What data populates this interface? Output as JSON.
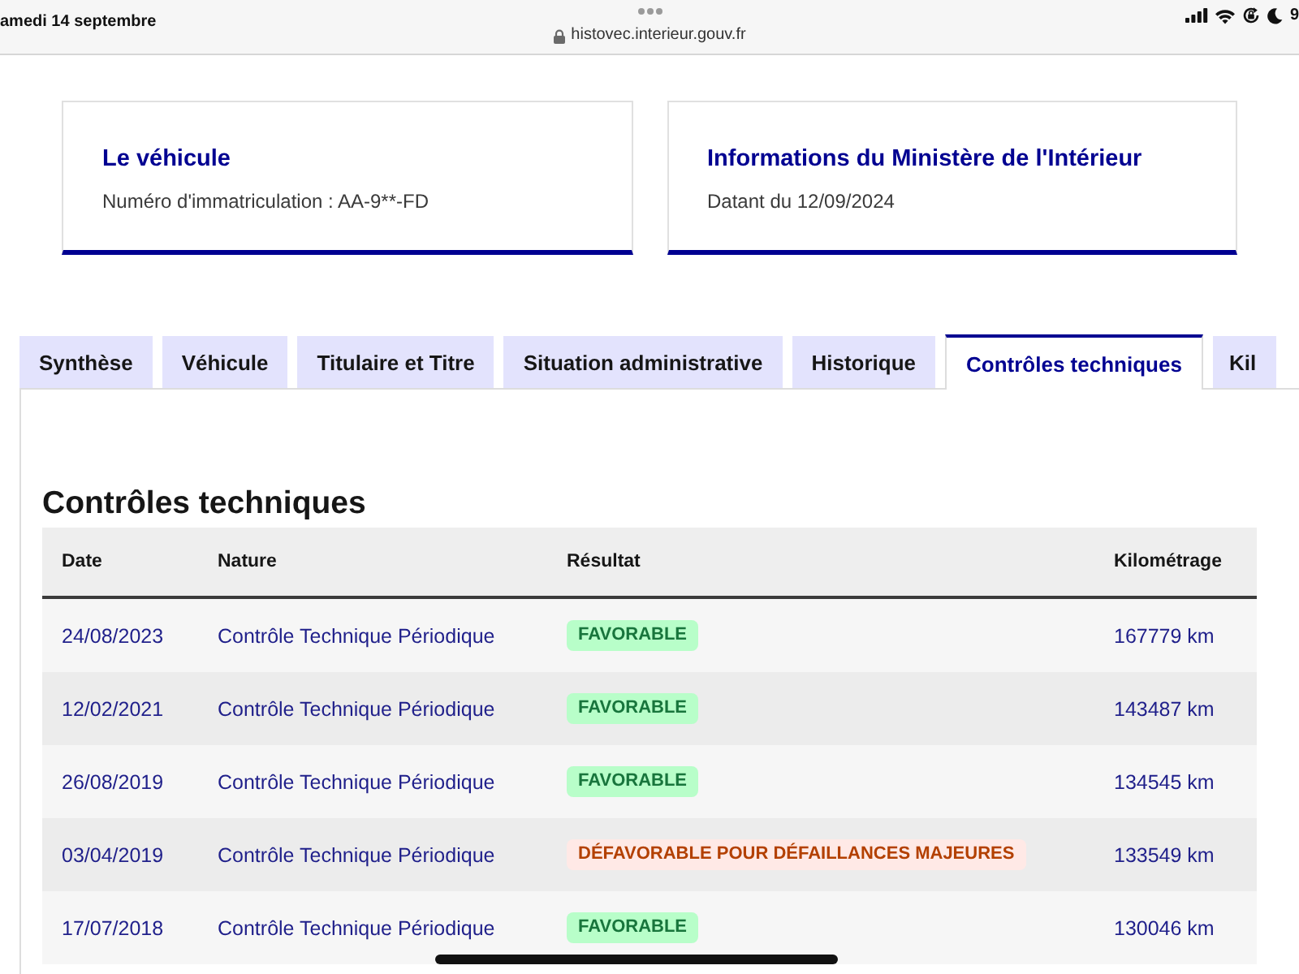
{
  "status_bar": {
    "date": "amedi 14 septembre",
    "url": "histovec.interieur.gouv.fr",
    "battery": "9"
  },
  "cards": [
    {
      "title": "Le véhicule",
      "text": "Numéro d'immatriculation : AA-9**-FD"
    },
    {
      "title": "Informations du Ministère de l'Intérieur",
      "text": "Datant du 12/09/2024"
    }
  ],
  "tabs": [
    {
      "label": "Synthèse",
      "selected": false
    },
    {
      "label": "Véhicule",
      "selected": false
    },
    {
      "label": "Titulaire et Titre",
      "selected": false
    },
    {
      "label": "Situation administrative",
      "selected": false
    },
    {
      "label": "Historique",
      "selected": false
    },
    {
      "label": "Contrôles techniques",
      "selected": true
    },
    {
      "label": "Kil",
      "selected": false
    }
  ],
  "section": {
    "title": "Contrôles techniques",
    "table": {
      "columns": [
        "Date",
        "Nature",
        "Résultat",
        "Kilométrage"
      ],
      "rows": [
        {
          "date": "24/08/2023",
          "nature": "Contrôle Technique Périodique",
          "result": {
            "label": "FAVORABLE",
            "kind": "favorable"
          },
          "mileage": "167779 km"
        },
        {
          "date": "12/02/2021",
          "nature": "Contrôle Technique Périodique",
          "result": {
            "label": "FAVORABLE",
            "kind": "favorable"
          },
          "mileage": "143487 km"
        },
        {
          "date": "26/08/2019",
          "nature": "Contrôle Technique Périodique",
          "result": {
            "label": "FAVORABLE",
            "kind": "favorable"
          },
          "mileage": "134545 km"
        },
        {
          "date": "03/04/2019",
          "nature": "Contrôle Technique Périodique",
          "result": {
            "label": "DÉFAVORABLE POUR DÉFAILLANCES MAJEURES",
            "kind": "unfavorable"
          },
          "mileage": "133549 km"
        },
        {
          "date": "17/07/2018",
          "nature": "Contrôle Technique Périodique",
          "result": {
            "label": "FAVORABLE",
            "kind": "favorable"
          },
          "mileage": "130046 km"
        }
      ]
    }
  }
}
